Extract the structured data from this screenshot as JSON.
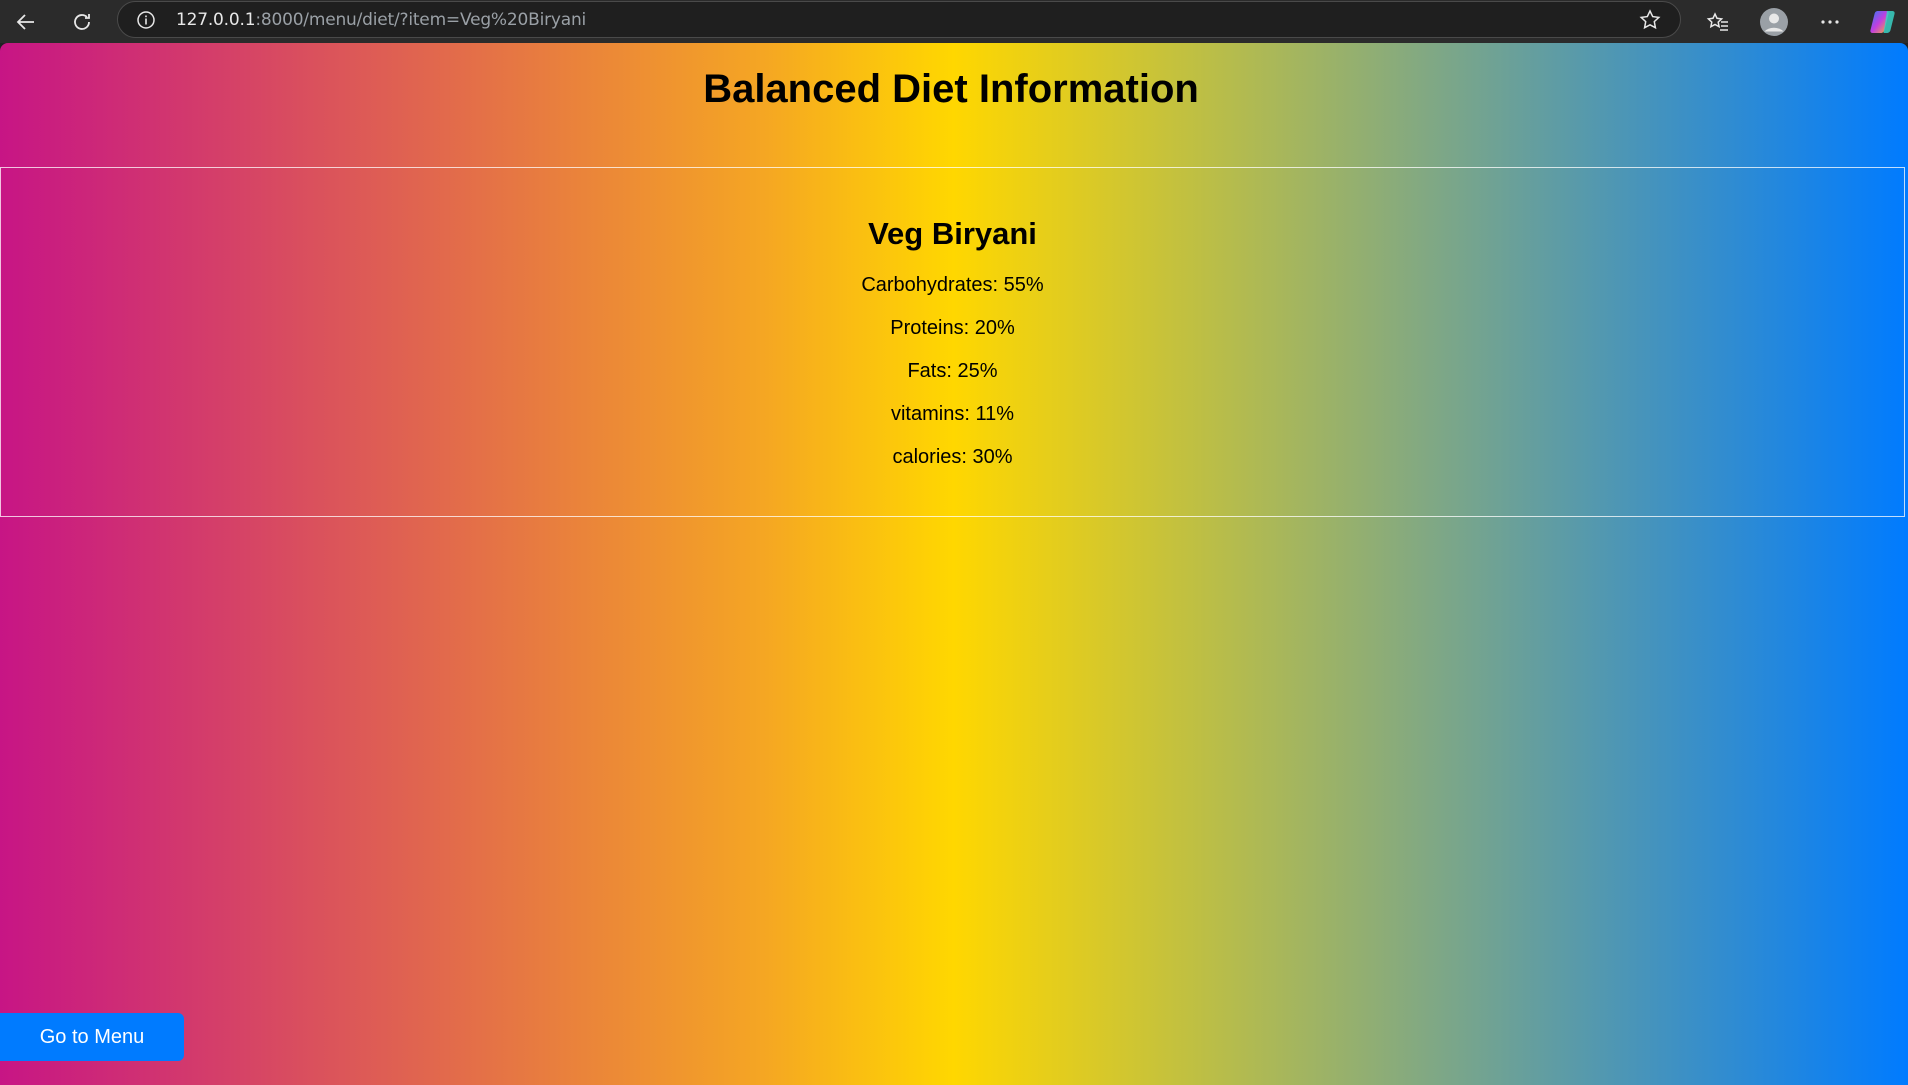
{
  "browser": {
    "url_host": "127.0.0.1",
    "url_rest": ":8000/menu/diet/?item=Veg%20Biryani"
  },
  "page": {
    "title": "Balanced Diet Information"
  },
  "diet": {
    "item_name": "Veg Biryani",
    "nutrients": [
      "Carbohydrates: 55%",
      "Proteins: 20%",
      "Fats: 25%",
      "vitamins: 11%",
      "calories: 30%"
    ]
  },
  "actions": {
    "menu_label": "Go to Menu"
  },
  "colors": {
    "gradient": [
      "#c71585",
      "#f5a623",
      "#ffd700",
      "#80a884",
      "#007bff"
    ],
    "button": "#007bff"
  }
}
